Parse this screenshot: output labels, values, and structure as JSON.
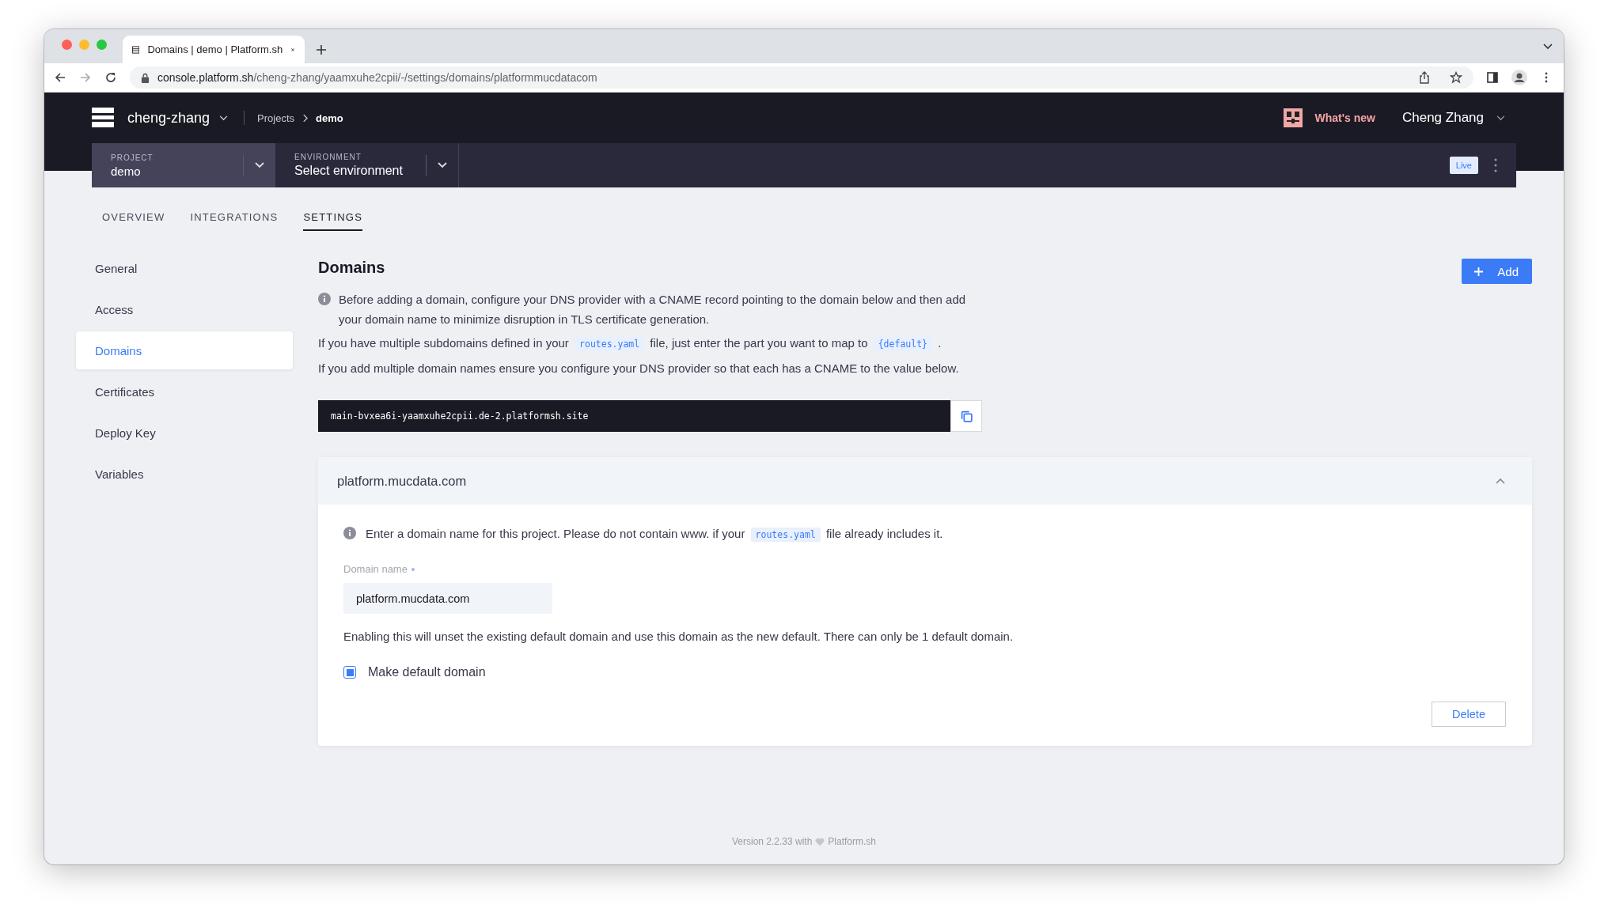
{
  "browser": {
    "tab_title": "Domains | demo | Platform.sh",
    "url_host": "console.platform.sh",
    "url_path": "/cheng-zhang/yaamxuhe2cpii/-/settings/domains/platformmucdatacom"
  },
  "header": {
    "organization": "cheng-zhang",
    "breadcrumbs": [
      "Projects",
      "demo"
    ],
    "whats_new": "What's new",
    "user_name": "Cheng Zhang"
  },
  "context_bar": {
    "project_label": "PROJECT",
    "project_value": "demo",
    "environment_label": "ENVIRONMENT",
    "environment_value": "Select environment",
    "badge": "Live"
  },
  "tabs": [
    {
      "label": "OVERVIEW",
      "selected": false
    },
    {
      "label": "INTEGRATIONS",
      "selected": false
    },
    {
      "label": "SETTINGS",
      "selected": true
    }
  ],
  "sidebar": {
    "items": [
      {
        "label": "General",
        "selected": false
      },
      {
        "label": "Access",
        "selected": false
      },
      {
        "label": "Domains",
        "selected": true
      },
      {
        "label": "Certificates",
        "selected": false
      },
      {
        "label": "Deploy Key",
        "selected": false
      },
      {
        "label": "Variables",
        "selected": false
      }
    ]
  },
  "domains": {
    "title": "Domains",
    "add_button": "Add",
    "info": "Before adding a domain, configure your DNS provider with a CNAME record pointing to the domain below and then add your domain name to minimize disruption in TLS certificate generation.",
    "subdomains_note": [
      {
        "kind": "text",
        "text": "If you have multiple subdomains defined in your"
      },
      {
        "kind": "code",
        "text": "routes.yaml"
      },
      {
        "kind": "text",
        "text": "file, just enter the part you want to map to"
      },
      {
        "kind": "code",
        "text": "{default}"
      },
      {
        "kind": "text",
        "text": "."
      }
    ],
    "cname_note": "If you add multiple domain names ensure you configure your DNS provider so that each has a CNAME to the value below.",
    "cname_value": "main-bvxea6i-yaamxuhe2cpii.de-2.platformsh.site",
    "domain_card": {
      "title": "platform.mucdata.com",
      "expanded": true,
      "info": [
        {
          "kind": "text",
          "text": "Enter a domain name for this project. Please do not contain www. if your"
        },
        {
          "kind": "code",
          "text": "routes.yaml"
        },
        {
          "kind": "text",
          "text": "file already includes it."
        }
      ],
      "field_label": "Domain name",
      "field_required": true,
      "field_value": "platform.mucdata.com",
      "default_note": "Enabling this will unset the existing default domain and use this domain as the new default. There can only be 1 default domain.",
      "default_checkbox": {
        "label": "Make default domain",
        "checked": true
      },
      "delete_button": "Delete"
    }
  },
  "footer": {
    "version": "Version 2.2.33 with",
    "brand": "Platform.sh"
  }
}
